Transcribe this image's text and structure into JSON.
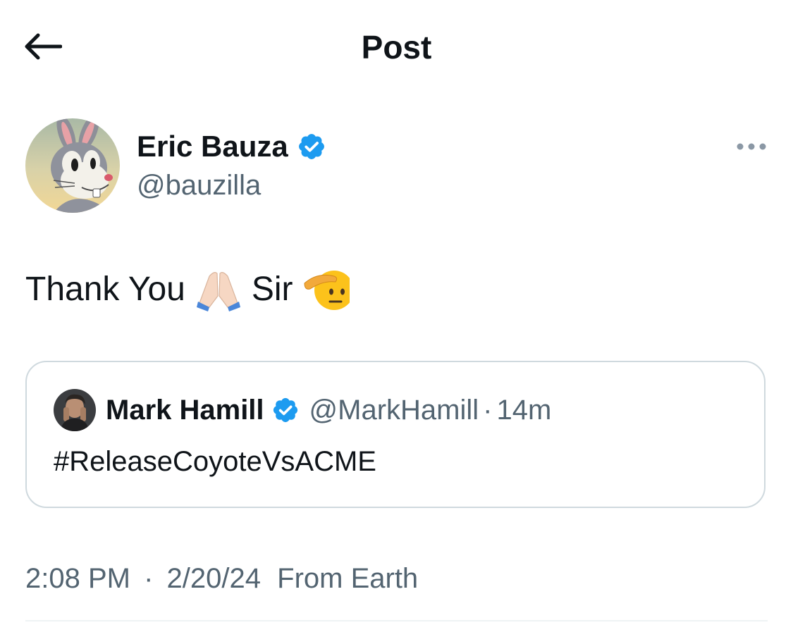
{
  "header": {
    "back_icon": "arrow-left-icon",
    "title": "Post"
  },
  "author": {
    "name": "Eric Bauza",
    "handle": "@bauzilla",
    "verified": true,
    "avatar_icon": "cartoon-rabbit-avatar"
  },
  "post": {
    "text_part1": "Thank You",
    "emoji1": "folded-hands-emoji",
    "text_part2": "Sir",
    "emoji2": "saluting-face-emoji"
  },
  "quote": {
    "name": "Mark Hamill",
    "handle": "@MarkHamill",
    "separator": "·",
    "time": "14m",
    "verified": true,
    "text": "#ReleaseCoyoteVsACME"
  },
  "meta": {
    "time": "2:08 PM",
    "separator": "·",
    "date": "2/20/24",
    "source": "From Earth"
  },
  "colors": {
    "text": "#0f1419",
    "muted": "#536471",
    "verified": "#1d9bf0",
    "border": "#cfd9de"
  }
}
